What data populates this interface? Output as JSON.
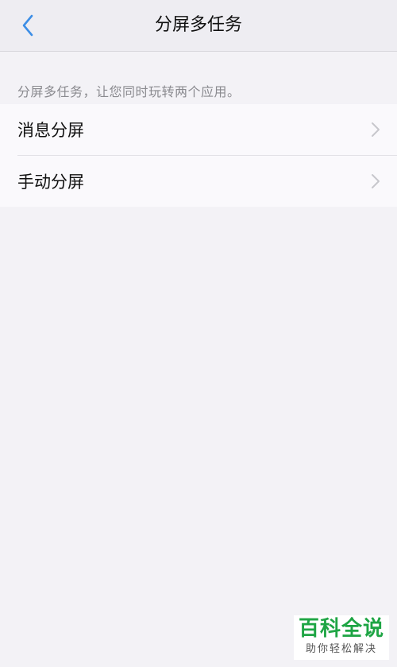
{
  "header": {
    "title": "分屏多任务",
    "back_icon": "chevron-left-icon"
  },
  "description": "分屏多任务，让您同时玩转两个应用。",
  "items": [
    {
      "label": "消息分屏",
      "icon": "chevron-right-icon"
    },
    {
      "label": "手动分屏",
      "icon": "chevron-right-icon"
    }
  ],
  "watermark": {
    "title": "百科全说",
    "subtitle": "助你轻松解决"
  },
  "colors": {
    "accent": "#3d8ee6",
    "background": "#f3f2f6",
    "chevron": "#c7c7cc",
    "watermark_green": "#1ea544"
  }
}
